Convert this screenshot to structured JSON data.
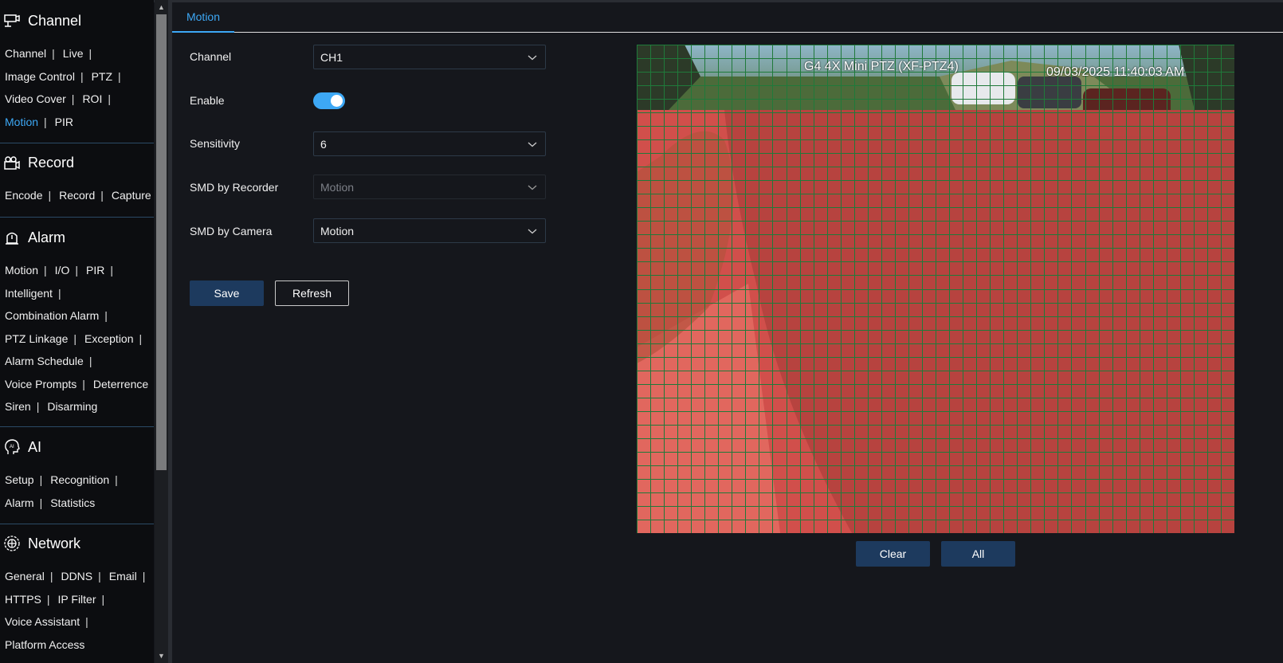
{
  "sidebar": {
    "sections": [
      {
        "title": "Channel",
        "icon": "camera-icon",
        "lines": [
          [
            {
              "label": "Channel"
            },
            {
              "label": "Live"
            }
          ],
          [
            {
              "label": "Image Control"
            },
            {
              "label": "PTZ"
            }
          ],
          [
            {
              "label": "Video Cover"
            },
            {
              "label": "ROI"
            }
          ],
          [
            {
              "label": "Motion",
              "active": true
            },
            {
              "label": "PIR",
              "last": true
            }
          ]
        ]
      },
      {
        "title": "Record",
        "icon": "video-record-icon",
        "lines": [
          [
            {
              "label": "Encode"
            },
            {
              "label": "Record"
            },
            {
              "label": "Capture",
              "last": true
            }
          ]
        ]
      },
      {
        "title": "Alarm",
        "icon": "alarm-light-icon",
        "lines": [
          [
            {
              "label": "Motion"
            },
            {
              "label": "I/O"
            },
            {
              "label": "PIR"
            }
          ],
          [
            {
              "label": "Intelligent"
            }
          ],
          [
            {
              "label": "Combination Alarm"
            }
          ],
          [
            {
              "label": "PTZ Linkage"
            },
            {
              "label": "Exception"
            }
          ],
          [
            {
              "label": "Alarm Schedule"
            }
          ],
          [
            {
              "label": "Voice Prompts"
            },
            {
              "label": "Deterrence"
            }
          ],
          [
            {
              "label": "Siren"
            },
            {
              "label": "Disarming",
              "last": true
            }
          ]
        ]
      },
      {
        "title": "AI",
        "icon": "ai-head-icon",
        "lines": [
          [
            {
              "label": "Setup"
            },
            {
              "label": "Recognition"
            }
          ],
          [
            {
              "label": "Alarm"
            },
            {
              "label": "Statistics",
              "last": true
            }
          ]
        ]
      },
      {
        "title": "Network",
        "icon": "network-globe-icon",
        "lines": [
          [
            {
              "label": "General"
            },
            {
              "label": "DDNS"
            },
            {
              "label": "Email"
            }
          ],
          [
            {
              "label": "HTTPS"
            },
            {
              "label": "IP Filter"
            }
          ],
          [
            {
              "label": "Voice Assistant"
            }
          ],
          [
            {
              "label": "Platform Access",
              "last": true
            }
          ]
        ]
      }
    ]
  },
  "tab": {
    "label": "Motion"
  },
  "form": {
    "channel_label": "Channel",
    "channel_value": "CH1",
    "enable_label": "Enable",
    "enable_on": true,
    "sensitivity_label": "Sensitivity",
    "sensitivity_value": "6",
    "smd_recorder_label": "SMD by Recorder",
    "smd_recorder_value": "Motion",
    "smd_camera_label": "SMD by Camera",
    "smd_camera_value": "Motion",
    "save_label": "Save",
    "refresh_label": "Refresh"
  },
  "video": {
    "osd_title": "G4 4X Mini PTZ (XF-PTZ4)",
    "osd_time": "09/03/2025 11:40:03 AM",
    "grid_color": "#1f7a3a",
    "motion_color": "#e0524d",
    "clear_label": "Clear",
    "all_label": "All"
  }
}
